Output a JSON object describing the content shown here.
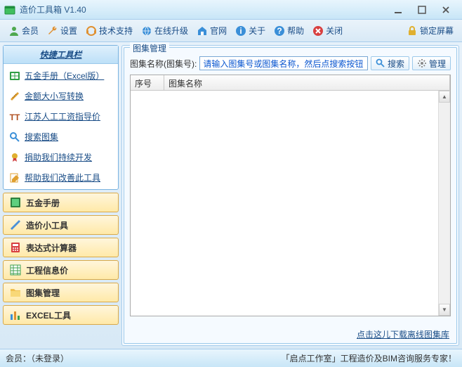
{
  "window": {
    "title": "造价工具箱 V1.40"
  },
  "toolbar": {
    "member": "会员",
    "settings": "设置",
    "support": "技术支持",
    "upgrade": "在线升级",
    "site": "官网",
    "about": "关于",
    "help": "帮助",
    "close": "关闭",
    "lock": "锁定屏幕"
  },
  "sidebar": {
    "quick_header": "快捷工具栏",
    "quick": [
      {
        "label": "五金手册（Excel版）"
      },
      {
        "label": "金额大小写转换"
      },
      {
        "label": "江苏人工工资指导价"
      },
      {
        "label": "搜索图集"
      },
      {
        "label": "捐助我们持续开发"
      },
      {
        "label": "帮助我们改善此工具"
      }
    ],
    "nav": [
      {
        "label": "五金手册"
      },
      {
        "label": "造价小工具"
      },
      {
        "label": "表达式计算器"
      },
      {
        "label": "工程信息价"
      },
      {
        "label": "图集管理"
      },
      {
        "label": "EXCEL工具"
      }
    ]
  },
  "main": {
    "legend": "图集管理",
    "search_label": "图集名称(图集号):",
    "search_value": "请输入图集号或图集名称，然后点搜索按钮！",
    "btn_search": "搜索",
    "btn_manage": "管理",
    "col1": "序号",
    "col2": "图集名称",
    "hint": "点击这儿下载离线图集库"
  },
  "status": {
    "left": "会员：（未登录）",
    "right": "「启点工作室」工程造价及BIM咨询服务专家！"
  }
}
